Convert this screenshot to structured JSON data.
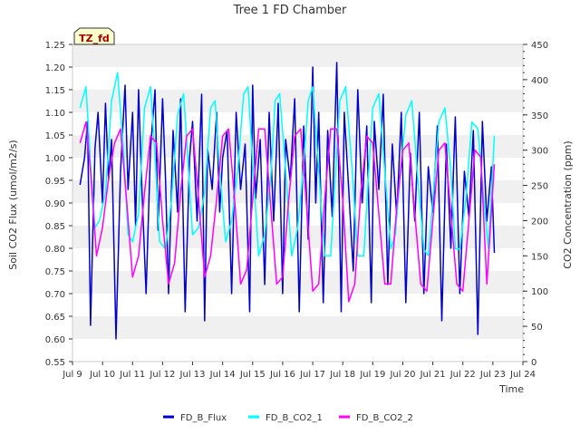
{
  "chart_data": {
    "type": "line",
    "title": "Tree 1 FD Chamber",
    "xlabel": "Time",
    "ylabel_left": "Soil CO2 Flux (umol/m2/s)",
    "ylabel_right": "CO2 Concentration (ppm)",
    "annotation": "TZ_fd",
    "x_range_days": [
      "Jul 9",
      "Jul 24"
    ],
    "x_ticks": [
      "Jul 9",
      "Jul 10",
      "Jul 11",
      "Jul 12",
      "Jul 13",
      "Jul 14",
      "Jul 15",
      "Jul 16",
      "Jul 17",
      "Jul 18",
      "Jul 19",
      "Jul 20",
      "Jul 21",
      "Jul 22",
      "Jul 23",
      "Jul 24"
    ],
    "y_left_range": [
      0.55,
      1.25
    ],
    "y_left_ticks": [
      "0.55",
      "0.60",
      "0.65",
      "0.70",
      "0.75",
      "0.80",
      "0.85",
      "0.90",
      "0.95",
      "1.00",
      "1.05",
      "1.10",
      "1.15",
      "1.20",
      "1.25"
    ],
    "y_right_range": [
      0,
      450
    ],
    "y_right_ticks": [
      "0",
      "50",
      "100",
      "150",
      "200",
      "250",
      "300",
      "350",
      "400",
      "450"
    ],
    "grid": "horizontal bands",
    "legend_position": "bottom-center",
    "series": [
      {
        "name": "FD_B_Flux",
        "axis": "left",
        "color": "#0000cc",
        "x": [
          9.25,
          9.4,
          9.5,
          9.6,
          9.75,
          9.85,
          10.0,
          10.1,
          10.2,
          10.3,
          10.45,
          10.6,
          10.75,
          10.85,
          11.0,
          11.1,
          11.2,
          11.3,
          11.45,
          11.6,
          11.75,
          11.85,
          12.0,
          12.1,
          12.2,
          12.35,
          12.5,
          12.6,
          12.75,
          12.9,
          13.0,
          13.15,
          13.3,
          13.4,
          13.5,
          13.65,
          13.8,
          13.9,
          14.0,
          14.15,
          14.3,
          14.45,
          14.6,
          14.75,
          14.9,
          15.0,
          15.1,
          15.25,
          15.4,
          15.55,
          15.7,
          15.85,
          16.0,
          16.1,
          16.25,
          16.4,
          16.55,
          16.7,
          16.85,
          17.0,
          17.1,
          17.2,
          17.35,
          17.5,
          17.65,
          17.8,
          17.95,
          18.05,
          18.2,
          18.35,
          18.5,
          18.65,
          18.8,
          18.95,
          19.05,
          19.2,
          19.35,
          19.5,
          19.65,
          19.8,
          19.95,
          20.1,
          20.25,
          20.4,
          20.55,
          20.7,
          20.85,
          21.0,
          21.15,
          21.3,
          21.45,
          21.6,
          21.75,
          21.9,
          22.05,
          22.2,
          22.35,
          22.5,
          22.65,
          22.8,
          22.95,
          23.05
        ],
        "values": [
          0.94,
          1.0,
          1.08,
          0.63,
          1.02,
          1.1,
          0.9,
          1.12,
          0.95,
          1.04,
          0.6,
          0.97,
          1.16,
          0.93,
          1.1,
          0.85,
          1.15,
          0.95,
          0.7,
          1.02,
          1.15,
          0.84,
          1.13,
          0.95,
          0.7,
          1.06,
          0.88,
          1.13,
          0.66,
          1.0,
          1.08,
          0.86,
          1.14,
          0.64,
          1.02,
          0.93,
          1.1,
          0.88,
          1.0,
          1.06,
          0.7,
          1.1,
          0.93,
          1.03,
          0.66,
          1.16,
          0.91,
          1.04,
          0.72,
          1.1,
          0.86,
          1.12,
          0.7,
          1.04,
          0.95,
          1.13,
          0.66,
          1.07,
          0.82,
          1.2,
          0.9,
          1.1,
          0.68,
          1.06,
          0.87,
          1.21,
          0.66,
          1.1,
          0.93,
          0.75,
          1.15,
          0.9,
          1.07,
          0.68,
          1.08,
          0.93,
          1.14,
          0.72,
          1.03,
          0.87,
          1.1,
          0.68,
          1.01,
          0.86,
          1.1,
          0.7,
          0.98,
          0.88,
          1.07,
          0.64,
          1.03,
          0.8,
          1.09,
          0.7,
          0.97,
          0.87,
          1.06,
          0.61,
          1.08,
          0.86,
          0.98,
          0.79
        ]
      },
      {
        "name": "FD_B_CO2_1",
        "axis": "right",
        "color": "#00ffff",
        "x": [
          9.25,
          9.45,
          9.6,
          9.75,
          9.9,
          10.1,
          10.3,
          10.5,
          10.7,
          10.85,
          11.0,
          11.2,
          11.4,
          11.6,
          11.75,
          11.9,
          12.1,
          12.3,
          12.5,
          12.7,
          12.85,
          13.0,
          13.2,
          13.4,
          13.6,
          13.75,
          13.9,
          14.1,
          14.3,
          14.5,
          14.7,
          14.85,
          15.0,
          15.2,
          15.4,
          15.6,
          15.75,
          15.9,
          16.1,
          16.3,
          16.5,
          16.7,
          16.85,
          17.0,
          17.2,
          17.4,
          17.6,
          17.75,
          17.9,
          18.1,
          18.3,
          18.5,
          18.7,
          18.85,
          19.0,
          19.2,
          19.4,
          19.6,
          19.75,
          19.9,
          20.1,
          20.3,
          20.5,
          20.7,
          20.85,
          21.0,
          21.2,
          21.4,
          21.6,
          21.75,
          21.9,
          22.1,
          22.3,
          22.5,
          22.7,
          22.85,
          23.05
        ],
        "values": [
          360,
          390,
          280,
          190,
          200,
          240,
          370,
          410,
          300,
          180,
          170,
          210,
          360,
          390,
          290,
          170,
          160,
          230,
          350,
          380,
          280,
          180,
          190,
          240,
          360,
          370,
          270,
          170,
          200,
          270,
          380,
          390,
          280,
          150,
          180,
          260,
          370,
          380,
          270,
          150,
          190,
          280,
          370,
          390,
          270,
          150,
          150,
          260,
          370,
          390,
          280,
          150,
          150,
          260,
          360,
          380,
          270,
          160,
          180,
          260,
          350,
          370,
          260,
          160,
          150,
          230,
          340,
          360,
          270,
          160,
          160,
          230,
          340,
          330,
          230,
          160,
          320
        ]
      },
      {
        "name": "FD_B_CO2_2",
        "axis": "right",
        "color": "#ff00ff",
        "x": [
          9.25,
          9.45,
          9.6,
          9.8,
          10.0,
          10.2,
          10.4,
          10.6,
          10.8,
          11.0,
          11.2,
          11.4,
          11.6,
          11.8,
          12.0,
          12.2,
          12.4,
          12.6,
          12.8,
          13.0,
          13.2,
          13.4,
          13.6,
          13.8,
          14.0,
          14.2,
          14.4,
          14.6,
          14.8,
          15.0,
          15.2,
          15.4,
          15.6,
          15.8,
          16.0,
          16.2,
          16.4,
          16.6,
          16.8,
          17.0,
          17.2,
          17.4,
          17.6,
          17.8,
          18.0,
          18.2,
          18.4,
          18.6,
          18.8,
          19.0,
          19.2,
          19.4,
          19.6,
          19.8,
          20.0,
          20.2,
          20.4,
          20.6,
          20.8,
          21.0,
          21.2,
          21.4,
          21.6,
          21.8,
          22.0,
          22.2,
          22.4,
          22.6,
          22.8,
          23.05
        ],
        "values": [
          310,
          340,
          270,
          150,
          190,
          260,
          310,
          330,
          230,
          120,
          150,
          240,
          320,
          310,
          200,
          110,
          140,
          240,
          320,
          330,
          230,
          120,
          150,
          230,
          320,
          330,
          230,
          110,
          130,
          230,
          330,
          330,
          220,
          110,
          120,
          230,
          320,
          330,
          220,
          100,
          110,
          230,
          330,
          330,
          230,
          85,
          110,
          240,
          320,
          310,
          210,
          110,
          110,
          220,
          300,
          310,
          210,
          110,
          100,
          200,
          300,
          310,
          210,
          110,
          100,
          200,
          300,
          290,
          110,
          280
        ]
      }
    ]
  }
}
